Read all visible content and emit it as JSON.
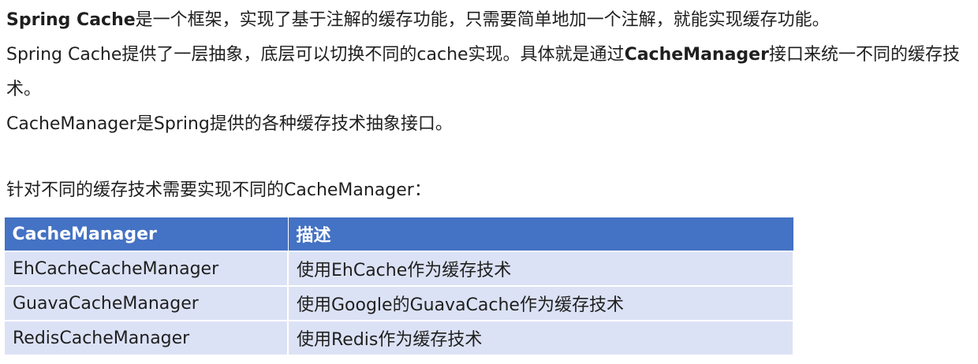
{
  "paragraphs": {
    "p1_bold": "Spring Cache",
    "p1_rest": "是一个框架，实现了基于注解的缓存功能，只需要简单地加一个注解，就能实现缓存功能。",
    "p2_start": "Spring Cache提供了一层抽象，底层可以切换不同的cache实现。具体就是通过",
    "p2_bold": "CacheManager",
    "p2_end": "接口来统一不同的缓存技术。",
    "p3": "CacheManager是Spring提供的各种缓存技术抽象接口。",
    "p4": "针对不同的缓存技术需要实现不同的CacheManager："
  },
  "table": {
    "headers": [
      "CacheManager",
      "描述"
    ],
    "rows": [
      [
        "EhCacheCacheManager",
        "使用EhCache作为缓存技术"
      ],
      [
        "GuavaCacheManager",
        "使用Google的GuavaCache作为缓存技术"
      ],
      [
        "RedisCacheManager",
        "使用Redis作为缓存技术"
      ]
    ]
  },
  "colors": {
    "header_bg": "#4472c4",
    "row_bg": "#dce2f5"
  }
}
